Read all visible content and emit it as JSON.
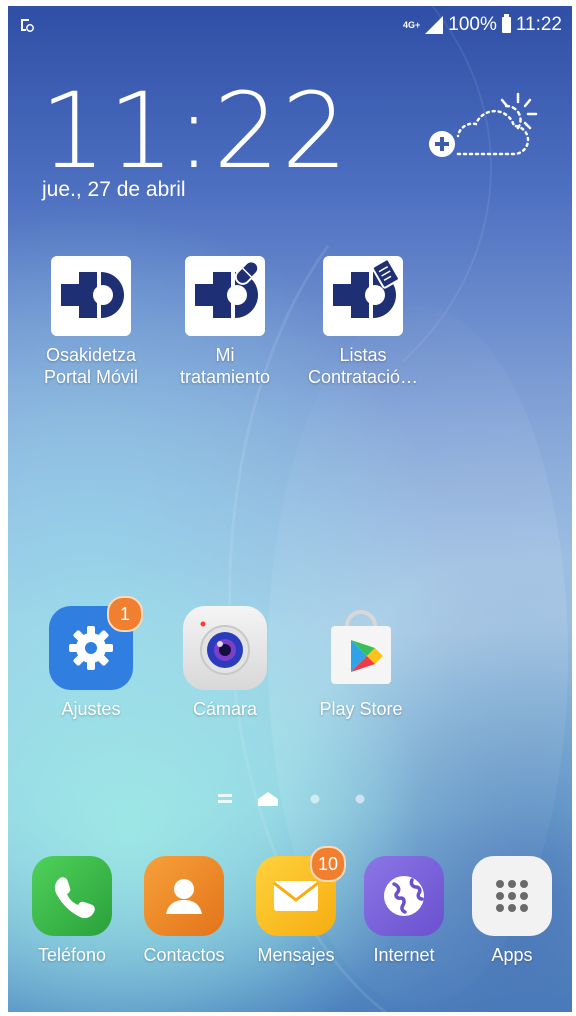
{
  "status_bar": {
    "network": "4G+",
    "battery": "100%",
    "time": "11:22"
  },
  "clock_widget": {
    "time": "11:22",
    "date": "jue., 27 de abril"
  },
  "home_apps": [
    {
      "label_line1": "Osakidetza",
      "label_line2": "Portal Móvil"
    },
    {
      "label_line1": "Mi",
      "label_line2": "tratamiento"
    },
    {
      "label_line1": "Listas",
      "label_line2": "Contratació…"
    }
  ],
  "row2_apps": [
    {
      "label": "Ajustes",
      "badge": "1"
    },
    {
      "label": "Cámara"
    },
    {
      "label": "Play Store"
    }
  ],
  "page_indicator": {
    "current_page": 1,
    "total_pages": 3
  },
  "dock": [
    {
      "label": "Teléfono"
    },
    {
      "label": "Contactos"
    },
    {
      "label": "Mensajes",
      "badge": "10"
    },
    {
      "label": "Internet"
    },
    {
      "label": "Apps"
    }
  ],
  "colors": {
    "badge": "#f08030",
    "settings": "#2f7ee0",
    "phone": "#3dc24a",
    "contacts": "#f08a24",
    "messages": "#ffc21a",
    "internet": "#7a63d8",
    "osakidetza": "#1f2f73"
  }
}
